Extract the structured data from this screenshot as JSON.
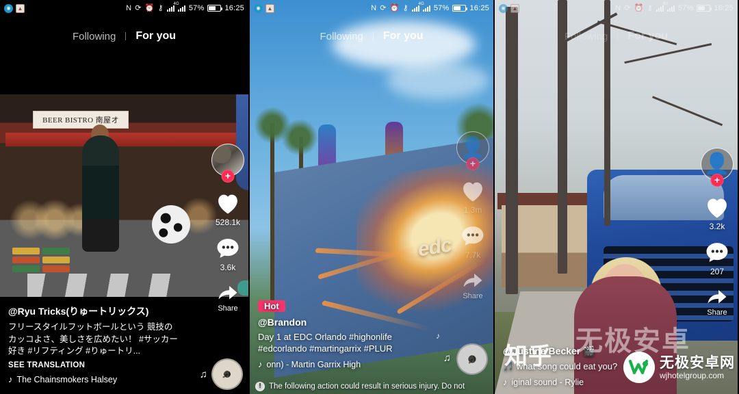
{
  "status_bar": {
    "icons": [
      "nfc-icon",
      "rotation-lock-icon",
      "alarm-icon",
      "vpn-key-icon",
      "signal-4g-icon",
      "signal-icon"
    ],
    "battery_percent": "57%",
    "time": "16:25"
  },
  "tabs": {
    "following": "Following",
    "for_you": "For you"
  },
  "panels": [
    {
      "id": "panel-soccer",
      "scene_text": "BEER BISTRO 南屋オ",
      "handle": "@Ryu Tricks(りゅートリックス)",
      "description": "フリースタイルフットボールという 競技のカッコよさ、美しさを広めたい！ #サッカー好き #リフティング #りゅートリ...",
      "see_translation": "SEE TRANSLATION",
      "music": "The Chainsmokers Halsey",
      "likes": "528.1k",
      "comments": "3.6k",
      "share_label": "Share",
      "badge": ""
    },
    {
      "id": "panel-edc",
      "scene_text": "edc",
      "badge": "Hot",
      "handle": "@Brandon",
      "description": "Day 1 at EDC Orlando #highonlife #edcorlando #martingarrix #PLUR",
      "music": "onn) - Martin Garrix    High",
      "likes": "1.3m",
      "comments": "7.7k",
      "share_label": "Share",
      "warning": "The following action could result in serious injury. Do not"
    },
    {
      "id": "panel-truck",
      "handle": "@Justine Becker 🎬",
      "description": "🎵 what song  could  eat  you?",
      "music": "iginal sound - Rylie",
      "likes": "3.2k",
      "comments": "207",
      "share_label": "Share",
      "badge": ""
    }
  ],
  "watermark": {
    "zhihu": "知乎",
    "ghost": "无极安卓",
    "site_cn": "无极安卓网",
    "site_url": "wjhotelgroup.com"
  },
  "colors": {
    "accent_pink": "#fe2c55",
    "hot_badge": "#f4366a",
    "text_white": "#ffffff"
  }
}
